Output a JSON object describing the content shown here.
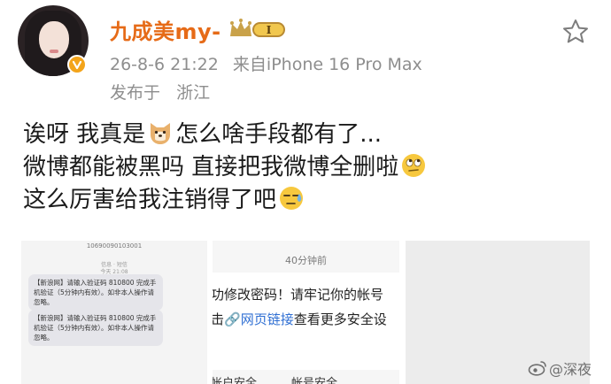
{
  "header": {
    "username": "九成美my-",
    "vip_badge": "I",
    "timestamp": "26-8-6 21:22",
    "source": "来自iPhone 16 Pro Max",
    "location_prefix": "发布于",
    "location": "浙江"
  },
  "post": {
    "line1_a": "诶呀 我真是",
    "line1_b": "怎么啥手段都有了...",
    "line2_a": "微博都能被黑吗 直接把我微博全删啦",
    "line3_a": "这么厉害给我注销得了吧"
  },
  "images": {
    "sms": {
      "number": "10690090103001",
      "time": "信息 · 短信\n今天 21:08",
      "message1": "【新浪网】请输入验证码 810800 完成手机验证（5分钟内有效）。如非本人操作请忽略。",
      "message2": "【新浪网】请输入验证码 810800 完成手机验证（5分钟内有效）。如非本人操作请忽略。"
    },
    "notice": {
      "time": "40分钟前",
      "line1": "功修改密码！请牢记你的帐号",
      "line2_a": "击",
      "link": "网页链接",
      "line2_b": "查看更多安全设",
      "footer": "帐户安全　　　帐号安全"
    }
  },
  "watermark": "@深夜"
}
